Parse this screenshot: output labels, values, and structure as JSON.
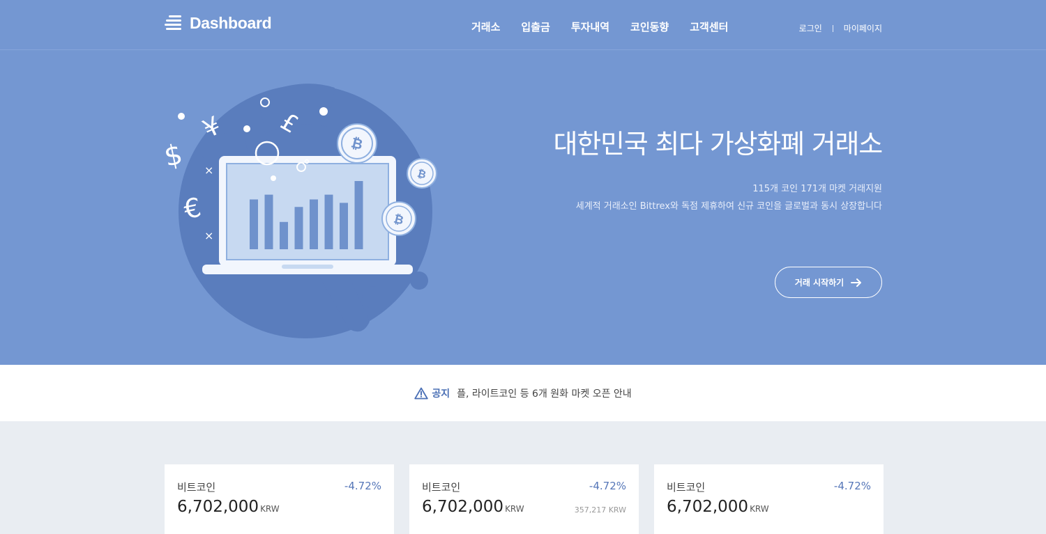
{
  "header": {
    "logo_text": "Dashboard",
    "nav": [
      {
        "label": "거래소"
      },
      {
        "label": "입출금"
      },
      {
        "label": "투자내역"
      },
      {
        "label": "코인동향"
      },
      {
        "label": "고객센터"
      }
    ],
    "login": "로그인",
    "mypage": "마이페이지"
  },
  "hero": {
    "title": "대한민국 최다 가상화폐 거래소",
    "subtitle_1": "115개 코인 171개 마켓 거래지원",
    "subtitle_2": "세계적 거래소인 Bittrex와 독점 제휴하여 신규 코인을 글로벌과 동시 상장합니다",
    "cta_label": "거래 시작하기",
    "chart_bar_levels": [
      0.73,
      0.8,
      0.4,
      0.62,
      0.73,
      0.8,
      0.68,
      1.0
    ],
    "currency_symbols": [
      "$",
      "¥",
      "€",
      "£",
      "×"
    ]
  },
  "notice": {
    "label": "공지",
    "text": "플, 라이트코인 등 6개 원화 마켓 오픈 안내"
  },
  "cards": [
    {
      "name": "비트코인",
      "change": "-4.72%",
      "price": "6,702,000",
      "unit": "KRW",
      "volume": ""
    },
    {
      "name": "비트코인",
      "change": "-4.72%",
      "price": "6,702,000",
      "unit": "KRW",
      "volume": "357,217 KRW"
    },
    {
      "name": "비트코인",
      "change": "-4.72%",
      "price": "6,702,000",
      "unit": "KRW",
      "volume": ""
    }
  ],
  "colors": {
    "brand": "#7497d2",
    "illustration_dark": "#5a7dbd",
    "accent_text": "#5576b8",
    "page_bg": "#e9edf2"
  }
}
